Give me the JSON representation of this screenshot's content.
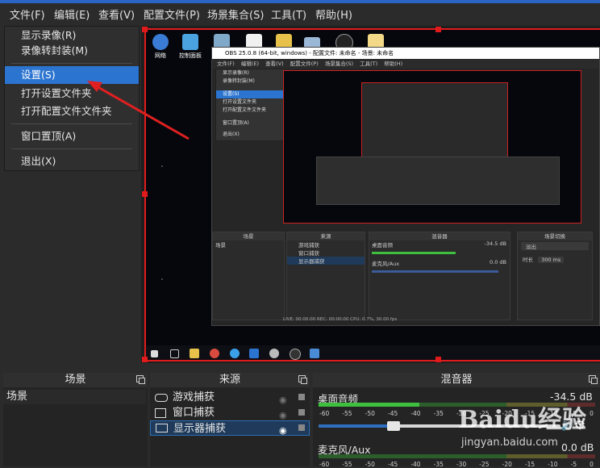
{
  "menubar": {
    "items": [
      "文件(F)",
      "编辑(E)",
      "查看(V)",
      "配置文件(P)",
      "场景集合(S)",
      "工具(T)",
      "帮助(H)"
    ]
  },
  "file_menu": {
    "items": [
      "显示录像(R)",
      "录像转封装(M)",
      "设置(S)",
      "打开设置文件夹",
      "打开配置文件文件夹",
      "窗口置顶(A)",
      "退出(X)"
    ],
    "active": "设置(S)"
  },
  "desktop_icons": [
    {
      "label": "网络"
    },
    {
      "label": "控制面板"
    },
    {
      "label": ""
    },
    {
      "label": ""
    },
    {
      "label": ""
    },
    {
      "label": ""
    },
    {
      "label": ""
    }
  ],
  "nested_obs": {
    "title": "OBS 25.0.8 (64-bit, windows) - 配置文件: 未命名 - 场景: 未命名",
    "menu": [
      "文件(F)",
      "编辑(E)",
      "查看(V)",
      "配置文件(P)",
      "场景集合(S)",
      "工具(T)",
      "帮助(H)"
    ],
    "file_menu": [
      "显示录像(R)",
      "录像转封装(M)",
      "设置(S)",
      "打开设置文件夹",
      "打开配置文件文件夹",
      "窗口置顶(A)",
      "退出(X)"
    ],
    "docks": [
      "场景",
      "来源",
      "混音器",
      "场景切换"
    ],
    "scene": "场景",
    "sources": [
      "游戏捕获",
      "窗口捕获",
      "显示器捕获"
    ],
    "mixer": [
      {
        "name": "桌面音频",
        "value": "-34.5 dB"
      },
      {
        "name": "麦克风/Aux",
        "value": "0.0 dB"
      }
    ],
    "transition": "淡出",
    "duration_label": "时长",
    "duration_value": "300 ms",
    "status": "LIVE: 00:00:00    REC: 00:00:00    CPU: 0.7%, 30.00 fps"
  },
  "docks": {
    "scenes": {
      "title": "场景",
      "items": [
        "场景"
      ]
    },
    "sources": {
      "title": "来源",
      "items": [
        "游戏捕获",
        "窗口捕获",
        "显示器捕获"
      ],
      "selected": "显示器捕获"
    },
    "mixer": {
      "title": "混音器",
      "channels": [
        {
          "name": "桌面音频",
          "value": "-34.5 dB",
          "slider_level": 0.47
        },
        {
          "name": "麦克风/Aux",
          "value": "0.0 dB"
        }
      ],
      "ticks": [
        "-60",
        "-55",
        "-50",
        "-45",
        "-40",
        "-35",
        "-30",
        "-25",
        "-20",
        "-15",
        "-10",
        "-5",
        "0"
      ]
    }
  },
  "watermark": {
    "logo": "Baidu经验",
    "url": "jingyan.baidu.com"
  },
  "colors": {
    "accent": "#2b74d0",
    "selection": "#e11b1b",
    "meter_green": "#3fbf3f",
    "meter_yellow": "#c8c83a",
    "meter_red": "#c23a3a"
  }
}
